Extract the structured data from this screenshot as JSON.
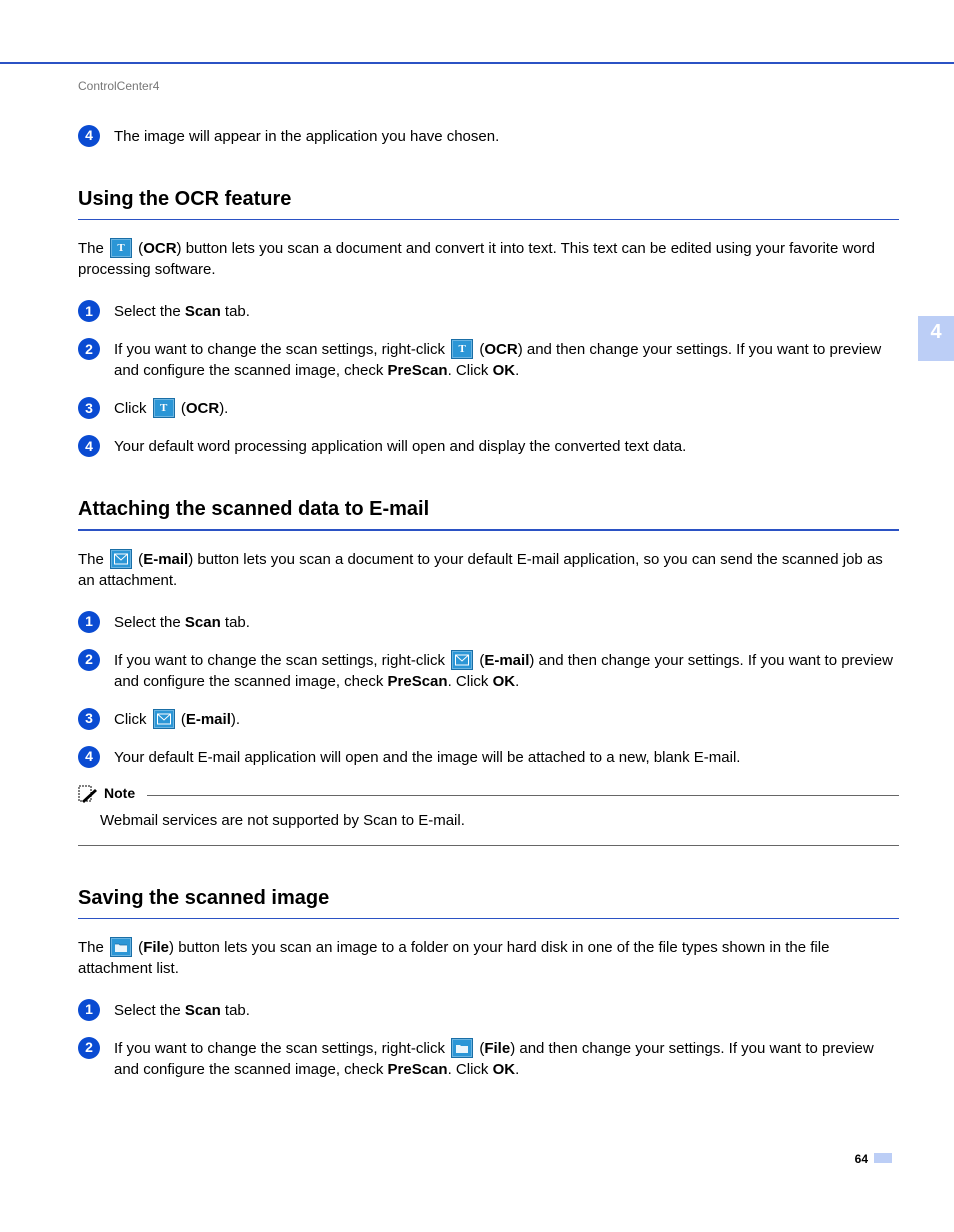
{
  "breadcrumb": "ControlCenter4",
  "side_tab": "4",
  "page_number": "64",
  "intro_step": {
    "num": "4",
    "text": "The image will appear in the application you have chosen."
  },
  "section_ocr": {
    "heading": "Using the OCR feature",
    "intro_pre": "The ",
    "intro_label": "OCR",
    "intro_post": ") button lets you scan a document and convert it into text. This text can be edited using your favorite word processing software.",
    "steps": [
      {
        "num": "1",
        "pre": "Select the ",
        "bold": "Scan",
        "post": " tab."
      },
      {
        "num": "2",
        "pre": "If you want to change the scan settings, right-click ",
        "label": "OCR",
        "mid": ") and then change your settings. If you want to preview and configure the scanned image, check ",
        "bold2": "PreScan",
        "mid2": ". Click ",
        "bold3": "OK",
        "post": "."
      },
      {
        "num": "3",
        "pre": "Click ",
        "label": "OCR",
        "post": ")."
      },
      {
        "num": "4",
        "text": "Your default word processing application will open and display the converted text data."
      }
    ]
  },
  "section_email": {
    "heading": "Attaching the scanned data to E-mail",
    "intro_pre": "The ",
    "intro_label": "E-mail",
    "intro_post": ") button lets you scan a document to your default E-mail application, so you can send the scanned job as an attachment.",
    "steps": [
      {
        "num": "1",
        "pre": "Select the ",
        "bold": "Scan",
        "post": " tab."
      },
      {
        "num": "2",
        "pre": "If you want to change the scan settings, right-click ",
        "label": "E-mail",
        "mid": ") and then change your settings. If you want to preview and configure the scanned image, check ",
        "bold2": "PreScan",
        "mid2": ". Click ",
        "bold3": "OK",
        "post": "."
      },
      {
        "num": "3",
        "pre": "Click ",
        "label": "E-mail",
        "post": ")."
      },
      {
        "num": "4",
        "text": "Your default E-mail application will open and the image will be attached to a new, blank E-mail."
      }
    ],
    "note_label": "Note",
    "note_text": "Webmail services are not supported by Scan to E-mail."
  },
  "section_file": {
    "heading": "Saving the scanned image",
    "intro_pre": "The ",
    "intro_label": "File",
    "intro_post": ") button lets you scan an image to a folder on your hard disk in one of the file types shown in the file attachment list.",
    "steps": [
      {
        "num": "1",
        "pre": "Select the ",
        "bold": "Scan",
        "post": " tab."
      },
      {
        "num": "2",
        "pre": "If you want to change the scan settings, right-click ",
        "label": "File",
        "mid": ") and then change your settings. If you want to preview and configure the scanned image, check ",
        "bold2": "PreScan",
        "mid2": ". Click ",
        "bold3": "OK",
        "post": "."
      }
    ]
  }
}
